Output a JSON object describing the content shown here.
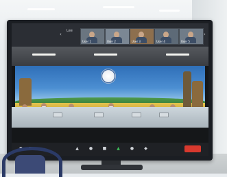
{
  "zoom": {
    "top_user_label": "Lee",
    "gallery_tiles": [
      {
        "name": "User 1"
      },
      {
        "name": "User 2"
      },
      {
        "name": "User 3"
      },
      {
        "name": "User 4"
      },
      {
        "name": "User 5"
      }
    ],
    "toolbar_icons": [
      "mute-icon",
      "video-icon",
      "security-icon",
      "participants-icon",
      "chat-icon",
      "share-screen-icon",
      "record-icon",
      "reactions-icon"
    ]
  },
  "banner": {
    "title": "",
    "subtitle": ""
  },
  "colors": {
    "backdrop_blue": "#2f6fb8",
    "field_yellow": "#e3c34d",
    "end_button_red": "#d8392e"
  }
}
